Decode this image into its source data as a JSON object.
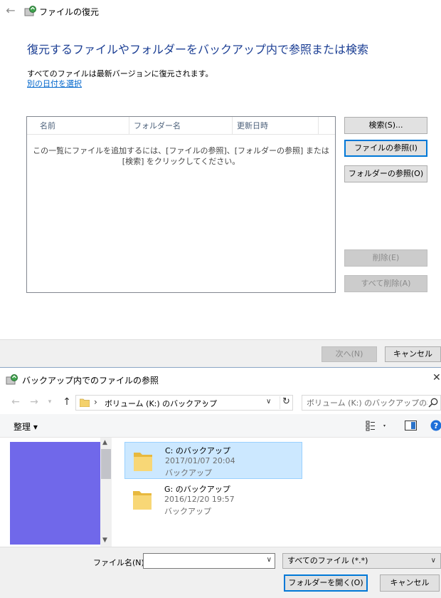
{
  "wizard": {
    "title": "ファイルの復元",
    "heading": "復元するファイルやフォルダーをバックアップ内で参照または検索",
    "info": "すべてのファイルは最新バージョンに復元されます。",
    "link": "別の日付を選択",
    "columns": [
      "名前",
      "フォルダー名",
      "更新日時"
    ],
    "empty_message": "この一覧にファイルを追加するには、[ファイルの参照]、[フォルダーの参照] または [検索] をクリックしてください。",
    "buttons": {
      "search": "検索(S)...",
      "browse_files": "ファイルの参照(I)",
      "browse_folders": "フォルダーの参照(O)",
      "remove": "削除(E)",
      "remove_all": "すべて削除(A)",
      "next": "次へ(N)",
      "cancel": "キャンセル"
    }
  },
  "dialog": {
    "title": "バックアップ内でのファイルの参照",
    "address": "ボリューム (K:) のバックアップ",
    "search_placeholder": "ボリューム (K:) のバックアップの検索",
    "organize": "整理 ▾",
    "items": [
      {
        "name": "C: のバックアップ",
        "date": "2017/01/07 20:04",
        "type": "バックアップ",
        "selected": true
      },
      {
        "name": "G: のバックアップ",
        "date": "2016/12/20 19:57",
        "type": "バックアップ",
        "selected": false
      }
    ],
    "filename_label": "ファイル名(N):",
    "filename_value": "",
    "filter": "すべてのファイル (*.*)",
    "open_button": "フォルダーを開く(O)",
    "cancel_button": "キャンセル"
  },
  "colors": {
    "accent": "#0078d7",
    "heading": "#1c3f94",
    "link": "#0066cc",
    "selection": "#cce8ff",
    "nav_block": "#7068ea"
  },
  "icons": [
    "back-arrow-icon",
    "restore-app-icon",
    "folder-icon",
    "refresh-icon",
    "search-icon",
    "view-options-icon",
    "preview-pane-icon",
    "help-icon",
    "close-icon"
  ]
}
